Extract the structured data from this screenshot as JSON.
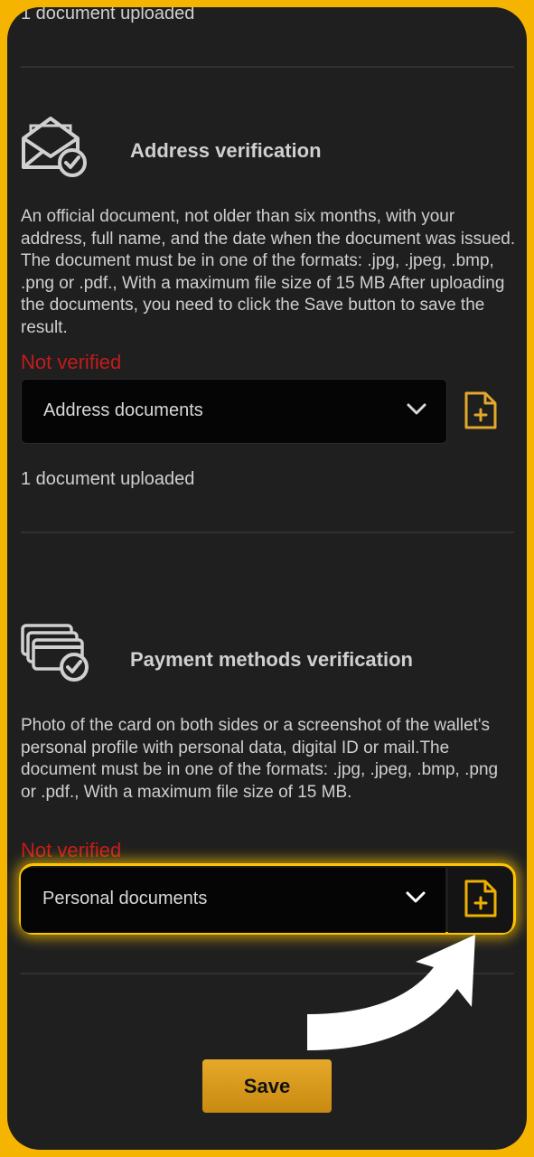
{
  "top": {
    "uploaded_text": "1 document uploaded"
  },
  "address": {
    "icon": "envelope-check-icon",
    "title": "Address verification",
    "description": "An official document, not older than six months, with your address, full name, and the date when the document was issued. The document must be in one of the formats: .jpg, .jpeg, .bmp, .png or .pdf., With a maximum file size of 15 MB After uploading the documents, you need to click the Save button to save the result.",
    "status": "Not verified",
    "select_value": "Address documents",
    "uploaded_text": "1 document uploaded"
  },
  "payment": {
    "icon": "cards-check-icon",
    "title": "Payment methods verification",
    "description": "Photo of the card on both sides or a screenshot of the wallet's personal profile with personal data, digital ID or mail.The document must be in one of the formats: .jpg, .jpeg, .bmp, .png or .pdf., With a maximum file size of 15 MB.",
    "status": "Not verified",
    "select_value": "Personal documents"
  },
  "actions": {
    "save_label": "Save"
  },
  "colors": {
    "frame": "#f5b400",
    "background": "#1f1f1f",
    "status_error": "#c41b1b",
    "accent": "#e6a92a"
  }
}
